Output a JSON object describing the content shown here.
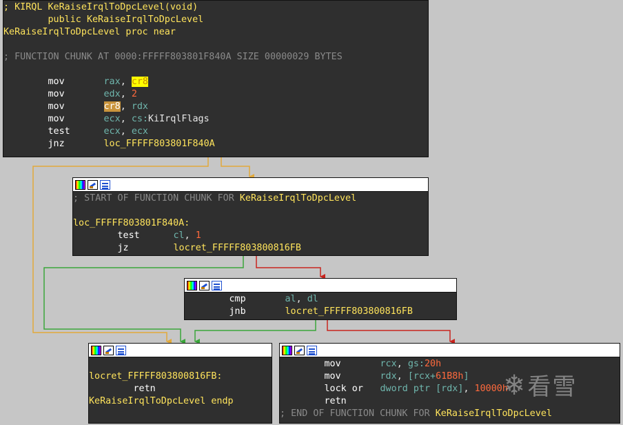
{
  "colors": {
    "background": "#c6c6c6",
    "node_bg": "#2f2f2f",
    "comment": "#8a8a8a",
    "label": "#ffe45c",
    "operand": "#6fb6ad",
    "number": "#ff6a3d",
    "edge_unconditional": "#e2a93a",
    "edge_true": "#3aa53a",
    "edge_false": "#c8251f"
  },
  "icons": {
    "color": "color-palette-icon",
    "rename": "rename-pencil-icon",
    "graph": "graph-view-icon"
  },
  "block_entry": {
    "line1": "; KIRQL KeRaiseIrqlToDpcLevel(void)",
    "public_kw": "public",
    "public_name": "KeRaiseIrqlToDpcLevel",
    "proc_name": "KeRaiseIrqlToDpcLevel",
    "proc_kw": "proc near",
    "chunk_comment": "; FUNCTION CHUNK AT 0000:FFFFF803801F840A SIZE 00000029 BYTES",
    "i1": {
      "mn": "mov",
      "op1": "rax",
      "sep": ", ",
      "op2": "cr8"
    },
    "i2": {
      "mn": "mov",
      "op1": "edx",
      "sep": ", ",
      "op2": "2"
    },
    "i3": {
      "mn": "mov",
      "op1": "cr8",
      "sep": ", ",
      "op2": "rdx"
    },
    "i4": {
      "mn": "mov",
      "op1": "ecx",
      "sep": ", ",
      "op2a": "cs:",
      "op2b": "KiIrqlFlags"
    },
    "i5": {
      "mn": "test",
      "op1": "ecx",
      "sep": ", ",
      "op2": "ecx"
    },
    "i6": {
      "mn": "jnz",
      "op1": "loc_FFFFF803801F840A"
    }
  },
  "block_chunk": {
    "comment": "; START OF FUNCTION CHUNK FOR ",
    "comment_name": "KeRaiseIrqlToDpcLevel",
    "label": "loc_FFFFF803801F840A:",
    "i1": {
      "mn": "test",
      "op1": "cl",
      "sep": ", ",
      "op2": "1"
    },
    "i2": {
      "mn": "jz",
      "op1": "locret_FFFFF803800816FB"
    }
  },
  "block_cmp": {
    "i1": {
      "mn": "cmp",
      "op1": "al",
      "sep": ", ",
      "op2": "dl"
    },
    "i2": {
      "mn": "jnb",
      "op1": "locret_FFFFF803800816FB"
    }
  },
  "block_ret": {
    "label": "locret_FFFFF803800816FB:",
    "i1": {
      "mn": "retn"
    },
    "endp_name": "KeRaiseIrqlToDpcLevel",
    "endp_kw": "endp"
  },
  "block_lock": {
    "i1": {
      "mn": "mov",
      "op1": "rcx",
      "sep": ", ",
      "op2a": "gs:",
      "op2b": "20h"
    },
    "i2": {
      "mn": "mov",
      "op1": "rdx",
      "sep": ", ",
      "op2a": "[rcx+",
      "op2b": "61B8h",
      "op2c": "]"
    },
    "i3": {
      "mn": "lock or",
      "op1": "dword ptr [rdx]",
      "sep": ", ",
      "op2": "10000h"
    },
    "i4": {
      "mn": "retn"
    },
    "end_comment": "; END OF FUNCTION CHUNK FOR ",
    "end_name": "KeRaiseIrqlToDpcLevel"
  },
  "watermark": {
    "text": "看雪"
  }
}
